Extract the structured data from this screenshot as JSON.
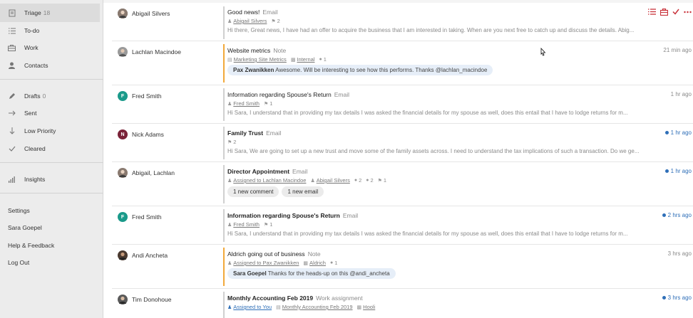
{
  "sidebar": {
    "triage_label": "Triage",
    "triage_count": "18",
    "todo_label": "To-do",
    "work_label": "Work",
    "contacts_label": "Contacts",
    "drafts_label": "Drafts",
    "drafts_count": "0",
    "sent_label": "Sent",
    "low_priority_label": "Low Priority",
    "cleared_label": "Cleared",
    "insights_label": "Insights",
    "settings_label": "Settings",
    "user_label": "Sara Goepel",
    "help_label": "Help & Feedback",
    "logout_label": "Log Out"
  },
  "rows": [
    {
      "sender": "Abigail Silvers",
      "title": "Good news!",
      "kind": "Email",
      "assignee": "Abigail Silvers",
      "flags": "2",
      "snippet": "Hi there, Great news, I have had an offer to acquire the business that I am interested in taking. When are you next free to catch up and discuss the details. Abig...",
      "time": ""
    },
    {
      "sender": "Lachlan Macindoe",
      "title": "Website metrics",
      "kind": "Note",
      "link1": "Marketing Site Metrics",
      "link2": "Internal",
      "comments": "1",
      "comment_author": "Pax Zwanikken",
      "comment_text": "Awesome. Will be interesting to see how this performs. Thanks @lachlan_macindoe",
      "time": "21 min ago"
    },
    {
      "sender": "Fred Smith",
      "title": "Information regarding Spouse's Return",
      "kind": "Email",
      "assignee": "Fred Smith",
      "flags": "1",
      "snippet": "Hi Sara, I understand that in providing my tax details I was asked the financial details for my spouse as well, does this entail that I have to lodge returns for m...",
      "time": "1 hr ago"
    },
    {
      "sender": "Nick Adams",
      "title": "Family Trust",
      "kind": "Email",
      "flags": "2",
      "snippet": "Hi Sara, We are going to set up a new trust and move some of the family assets across. I need to understand the tax implications of such a transaction. Do we ge...",
      "time": "1 hr ago"
    },
    {
      "sender": "Abigail, Lachlan",
      "title": "Director Appointment",
      "kind": "Email",
      "assigned": "Assigned to Lachlan Macindoe",
      "assignee": "Abigail Silvers",
      "people": "2",
      "comments": "2",
      "flags": "1",
      "chip1": "1 new comment",
      "chip2": "1 new email",
      "time": "1 hr ago"
    },
    {
      "sender": "Fred Smith",
      "title": "Information regarding Spouse's Return",
      "kind": "Email",
      "assignee": "Fred Smith",
      "flags": "1",
      "snippet": "Hi Sara, I understand that in providing my tax details I was asked the financial details for my spouse as well, does this entail that I have to lodge returns for m...",
      "time": "2 hrs ago"
    },
    {
      "sender": "Andi Ancheta",
      "title": "Aldrich going out of business",
      "kind": "Note",
      "assigned": "Assigned to Pax Zwanikken",
      "link2": "Aldrich",
      "comments": "1",
      "comment_author": "Sara Goepel",
      "comment_text": "Thanks for the heads-up on this @andi_ancheta",
      "time": "3 hrs ago"
    },
    {
      "sender": "Tim Donohoue",
      "title": "Monthly Accounting Feb 2019",
      "kind": "Work assignment",
      "assigned": "Assigned to You",
      "link1": "Monthly Accounting Feb 2019",
      "link2": "Hooli",
      "time": "3 hrs ago"
    }
  ],
  "colors": {
    "accent_red": "#c8323a",
    "unread_blue": "#2f6fb8",
    "note_orange": "#f2a93b",
    "avatar_teal": "#1a9a8a",
    "avatar_maroon": "#7a2238"
  }
}
